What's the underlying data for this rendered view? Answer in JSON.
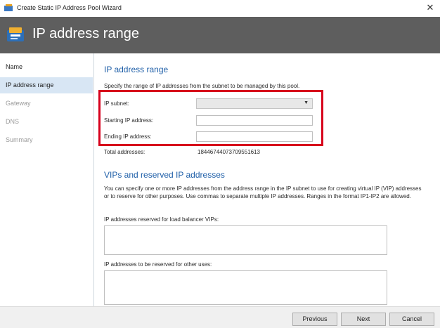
{
  "window": {
    "title": "Create Static IP Address Pool Wizard",
    "close_glyph": "✕"
  },
  "banner": {
    "title": "IP address range",
    "icon": "wizard-icon"
  },
  "sidebar": {
    "items": [
      {
        "label": "Name"
      },
      {
        "label": "IP address range"
      },
      {
        "label": "Gateway"
      },
      {
        "label": "DNS"
      },
      {
        "label": "Summary"
      }
    ]
  },
  "section1": {
    "heading": "IP address range",
    "description": "Specify the range of IP addresses from the subnet to be managed by this pool.",
    "ip_subnet_label": "IP subnet:",
    "ip_subnet_value": "",
    "starting_label": "Starting IP address:",
    "starting_value": "",
    "ending_label": "Ending IP address:",
    "ending_value": "",
    "total_label": "Total addresses:",
    "total_value": "18446744073709551613"
  },
  "section2": {
    "heading": "VIPs and reserved IP addresses",
    "paragraph": "You can specify one or more IP addresses from the address range in the IP subnet to use for creating virtual IP (VIP) addresses or to reserve for other purposes. Use commas to separate multiple IP addresses. Ranges in the format IP1-IP2 are allowed.",
    "vip_label": "IP addresses reserved for load balancer VIPs:",
    "vip_value": "",
    "other_label": "IP addresses to be reserved for other uses:",
    "other_value": ""
  },
  "footer": {
    "previous": "Previous",
    "next": "Next",
    "cancel": "Cancel"
  },
  "colors": {
    "banner": "#5e5e5e",
    "heading": "#1f5fa8",
    "highlight": "#d7001c",
    "selected": "#d8e6f4"
  }
}
